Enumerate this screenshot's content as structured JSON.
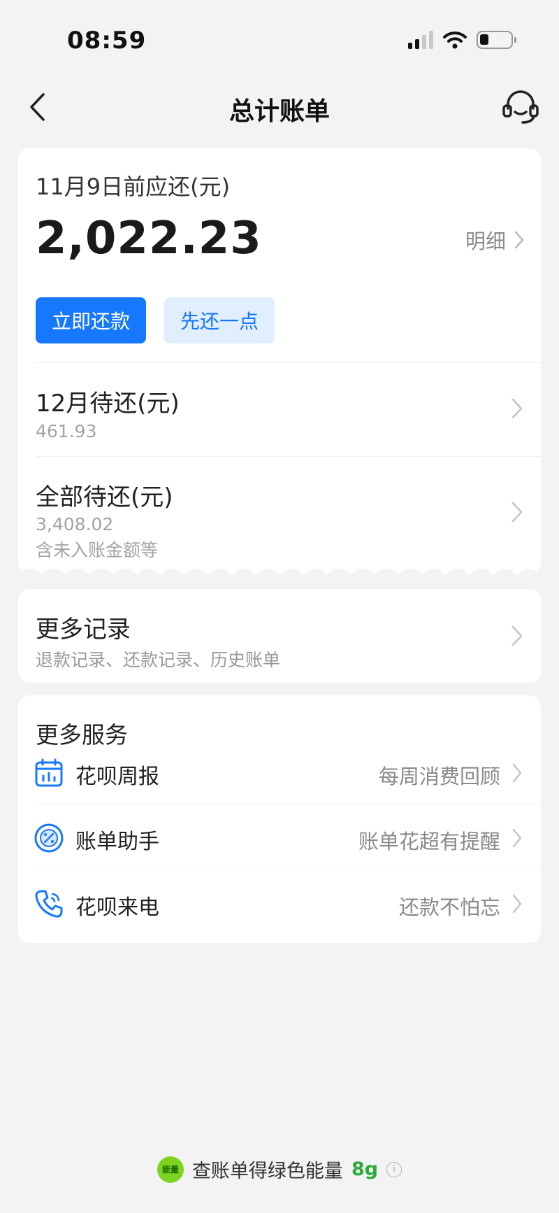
{
  "status_bar": {
    "time": "08:59"
  },
  "nav": {
    "title": "总计账单"
  },
  "bill": {
    "due_label": "11月9日前应还(元)",
    "due_amount": "2,022.23",
    "detail_link": "明细",
    "pay_now_button": "立即还款",
    "pay_part_button": "先还一点",
    "december_label": "12月待还(元)",
    "december_amount": "461.93",
    "all_label": "全部待还(元)",
    "all_amount": "3,408.02",
    "all_note": "含未入账金额等"
  },
  "records": {
    "title": "更多记录",
    "subtitle": "退款记录、还款记录、历史账单"
  },
  "services": {
    "heading": "更多服务",
    "items": [
      {
        "label": "花呗周报",
        "hint": "每周消费回顾",
        "icon": "calendar-chart-icon"
      },
      {
        "label": "账单助手",
        "hint": "账单花超有提醒",
        "icon": "percent-circle-icon"
      },
      {
        "label": "花呗来电",
        "hint": "还款不怕忘",
        "icon": "phone-icon"
      }
    ]
  },
  "footer": {
    "badge": "能量",
    "text": "查账单得绿色能量",
    "energy": "8g",
    "info": "i"
  },
  "colors": {
    "accent": "#1677ff",
    "accent_light": "#e0eefe",
    "energy_green": "#2bab3a"
  }
}
